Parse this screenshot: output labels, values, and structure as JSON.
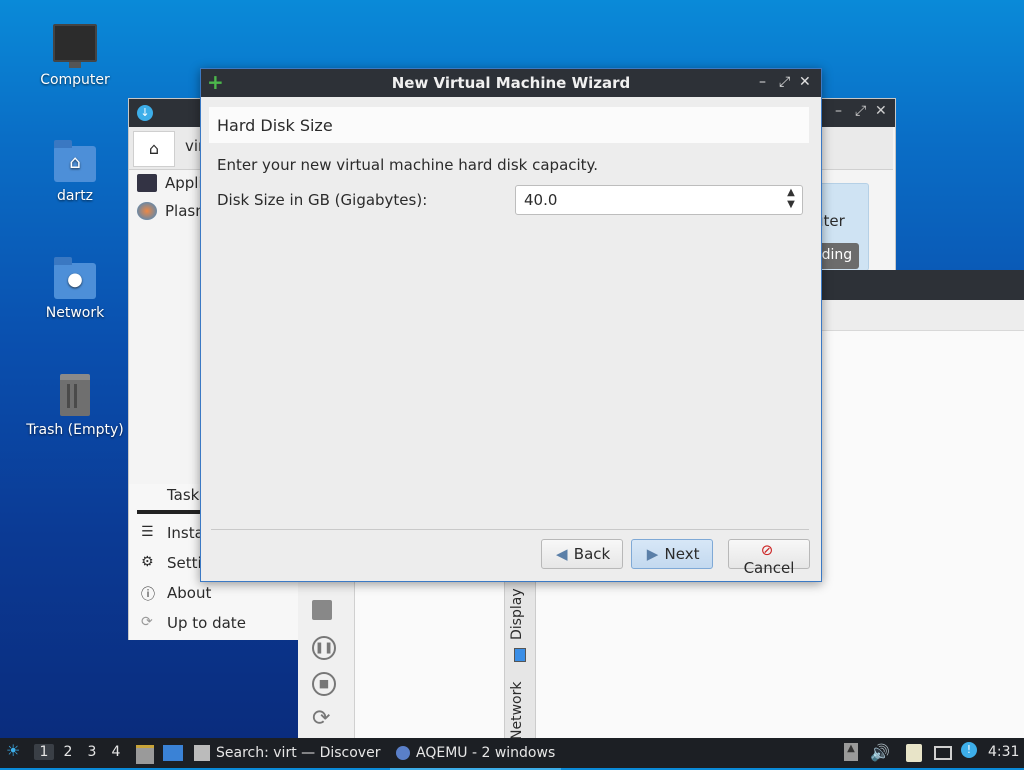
{
  "desktop": {
    "icons": [
      {
        "label": "Computer"
      },
      {
        "label": "dartz"
      },
      {
        "label": "Network"
      },
      {
        "label": "Trash (Empty)"
      }
    ]
  },
  "discover_window": {
    "search_text": "vir",
    "sidebar": [
      "Appli",
      "Plasm"
    ],
    "tasks_label": "Tasks",
    "tasks_items": [
      "Insta",
      "Setti",
      "About",
      "Up to date"
    ],
    "card_text": "uter",
    "pill_text": "ading"
  },
  "aqemu_window": {
    "vertical_tabs": [
      "Display",
      "Network"
    ]
  },
  "wizard": {
    "title": "New Virtual Machine Wizard",
    "header": "Hard Disk Size",
    "description": "Enter your new virtual machine hard disk capacity.",
    "disk_label": "Disk Size in GB (Gigabytes):",
    "disk_value": "40.0",
    "buttons": {
      "back": "Back",
      "next": "Next",
      "cancel": "Cancel"
    }
  },
  "taskbar": {
    "workspaces": [
      "1",
      "2",
      "3",
      "4"
    ],
    "tasks": [
      "Search: virt — Discover",
      "AQEMU - 2 windows"
    ],
    "clock": "4:31"
  },
  "colors": {
    "accent": "#3daee9",
    "titlebar": "#2d3137",
    "cancel_red": "#cc2222",
    "plus_green": "#4cb84c"
  }
}
